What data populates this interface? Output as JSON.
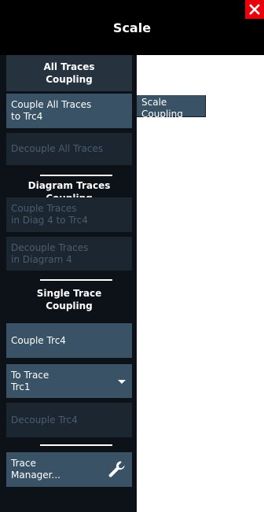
{
  "header": {
    "title": "Scale"
  },
  "close": {
    "icon": "close-icon",
    "color": "#e8000b"
  },
  "sections": {
    "all_traces": {
      "heading_line1": "All Traces",
      "heading_line2": "Coupling",
      "couple_all_label": "Couple All Traces\nto Trc4",
      "decouple_all_label": "Decouple All Traces"
    },
    "diagram_traces": {
      "heading_line1": "Diagram Traces",
      "heading_line2": "Coupling",
      "couple_diag_label": "Couple Traces\nin Diag 4 to Trc4",
      "decouple_diag_label": "Decouple Traces\nin Diagram 4"
    },
    "single_trace": {
      "heading_line1": "Single Trace",
      "heading_line2": "Coupling",
      "couple_trc_label": "Couple Trc4",
      "to_trace_label": "To Trace",
      "to_trace_value": "Trc1",
      "decouple_trc_label": "Decouple Trc4"
    }
  },
  "trace_manager": {
    "label": "Trace\nManager...",
    "icon": "wrench-icon"
  },
  "submenu": {
    "scale_coupling_label": "Scale\nCoupling"
  },
  "colors": {
    "header_bg": "#000000",
    "sidebar_bg": "#0c1218",
    "section_bg": "#26333f",
    "active_button_bg": "#3a5265",
    "disabled_button_bg": "#1c2631",
    "disabled_text": "#4a5d6e"
  }
}
